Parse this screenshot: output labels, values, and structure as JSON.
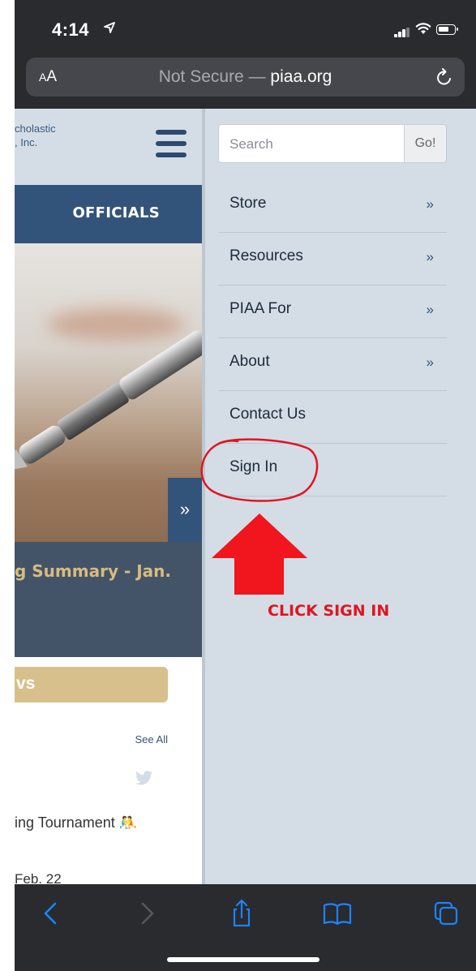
{
  "status_bar": {
    "time": "4:14"
  },
  "browser": {
    "aa_big": "A",
    "aa_small": "A",
    "url_prefix": "Not Secure — ",
    "url_domain": "piaa.org"
  },
  "background_page": {
    "org_name": "cholastic\n, Inc.",
    "nav_officials": "OFFICIALS",
    "slider_next": "»",
    "headline": "g Summary - Jan.",
    "news_tab": "vs",
    "see_all": "See All",
    "tournament": "ing Tournament 🤼",
    "date": "Feb. 22"
  },
  "menu": {
    "search_placeholder": "Search",
    "go_label": "Go!",
    "items": [
      {
        "label": "Store",
        "chevron": "»"
      },
      {
        "label": "Resources",
        "chevron": "»"
      },
      {
        "label": "PIAA For",
        "chevron": "»"
      },
      {
        "label": "About",
        "chevron": "»"
      },
      {
        "label": "Contact Us",
        "chevron": ""
      },
      {
        "label": "Sign In",
        "chevron": ""
      }
    ]
  },
  "annotation": {
    "text": "CLICK SIGN IN",
    "color": "#e0151f"
  },
  "colors": {
    "navy": "#33547a",
    "panel": "#d4dde6",
    "gold": "#d8bb7e",
    "ios_blue": "#1a84ff"
  }
}
